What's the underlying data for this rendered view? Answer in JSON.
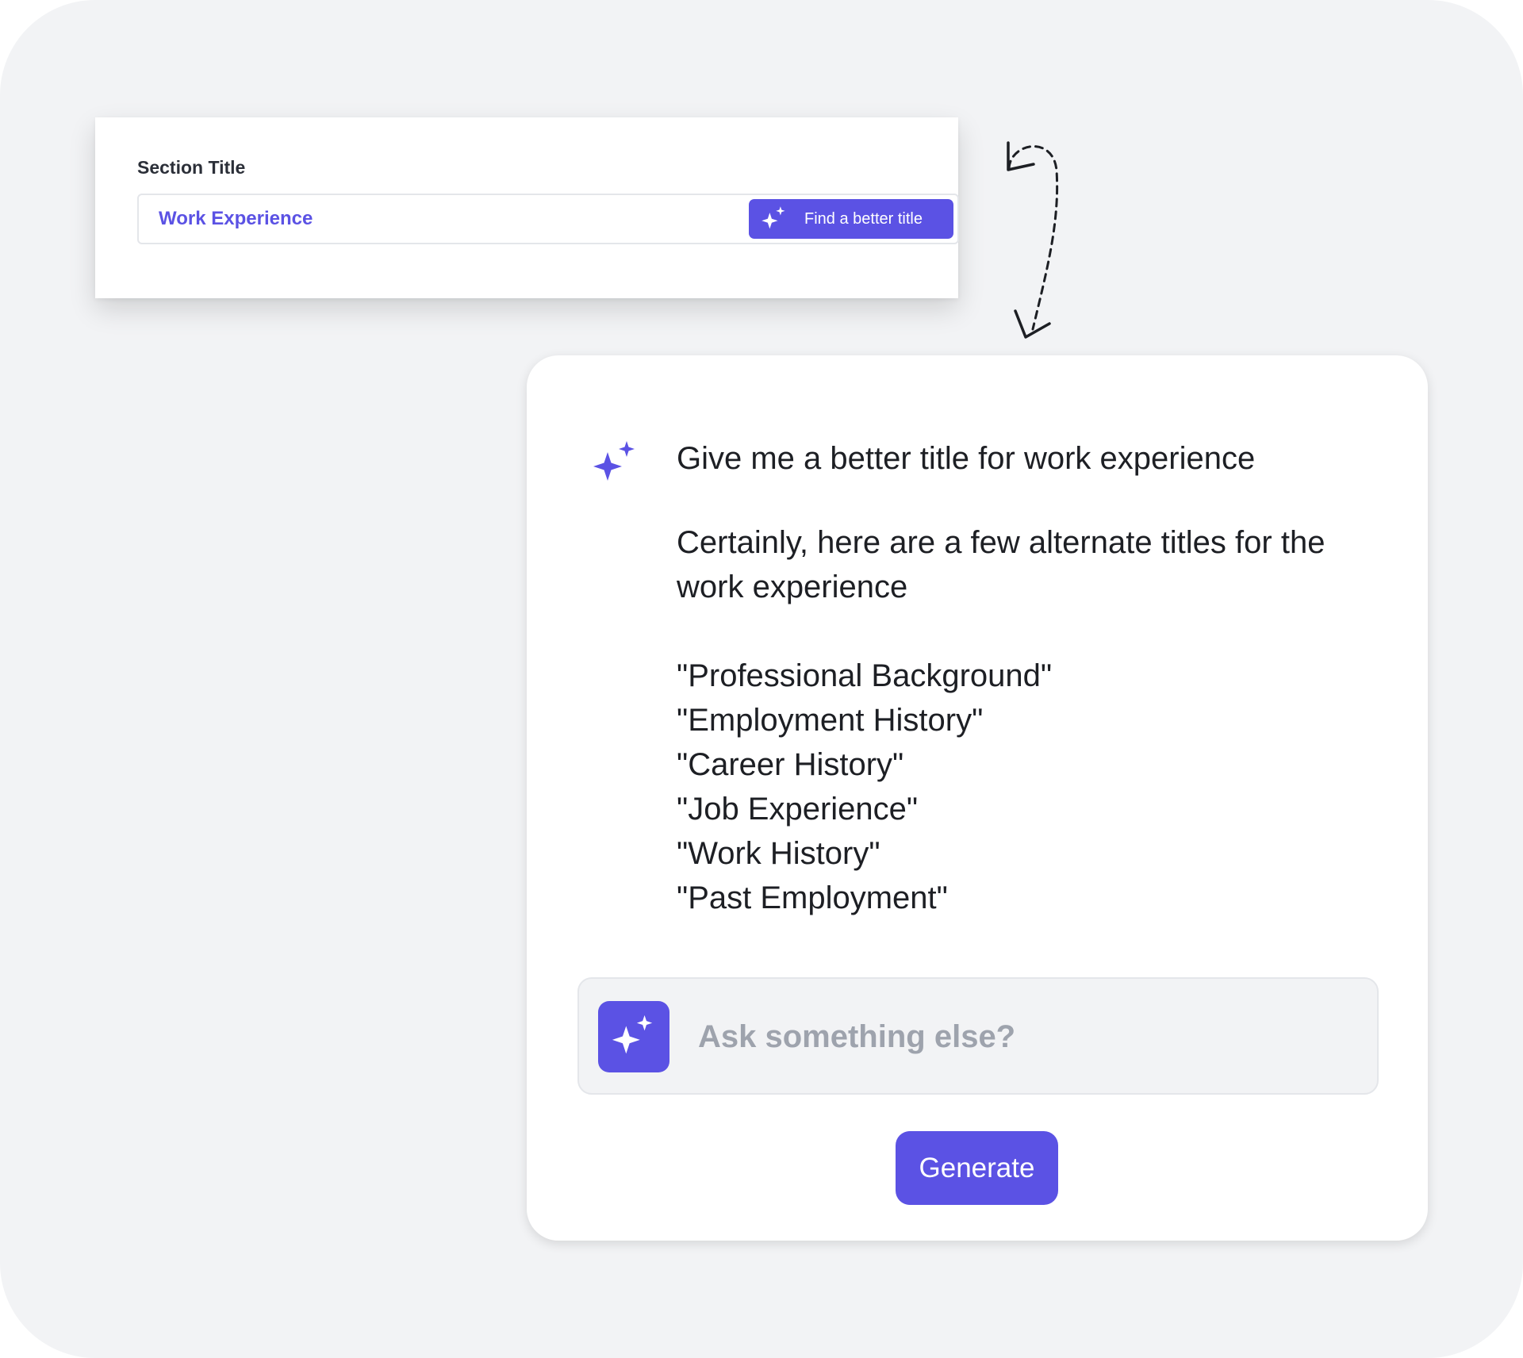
{
  "section": {
    "label": "Section Title",
    "value": "Work Experience",
    "button_label": "Find a better title",
    "button_icon": "sparkle-icon"
  },
  "chat": {
    "prompt": "Give me a better title for work experience",
    "answer": "Certainly, here are a few alternate titles for the work experience",
    "options": [
      "\"Professional Background\"",
      "\"Employment History\"",
      "\"Career History\"",
      "\"Job Experience\"",
      "\"Work History\"",
      "\"Past Employment\""
    ],
    "ask_placeholder": "Ask something else?",
    "generate_label": "Generate"
  },
  "colors": {
    "accent": "#5b52e4",
    "background": "#f2f3f5",
    "text": "#1d1f24",
    "placeholder": "#9ea3ad"
  }
}
